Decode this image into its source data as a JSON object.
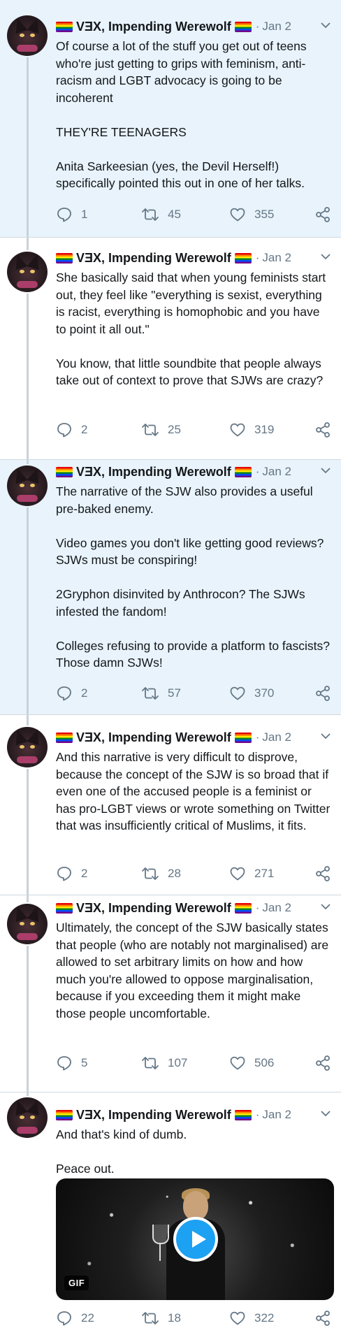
{
  "colors": {
    "shaded_bg": "#e8f3fb",
    "text": "#14171a",
    "muted": "#657786",
    "play_button": "#1da1f2"
  },
  "tweets": [
    {
      "name": "VƎX, Impending Werewolf",
      "dot": "·",
      "date": "Jan 2",
      "paragraphs": [
        "Of course a lot of the stuff you get out of teens who're just getting to grips with feminism, anti-racism and LGBT advocacy is going to be incoherent",
        "THEY'RE TEENAGERS",
        "Anita Sarkeesian (yes, the Devil Herself!) specifically pointed this out in one of her talks."
      ],
      "replies": "1",
      "retweets": "45",
      "likes": "355"
    },
    {
      "name": "VƎX, Impending Werewolf",
      "dot": "·",
      "date": "Jan 2",
      "paragraphs": [
        "She basically said that when young feminists start out, they feel like \"everything is sexist, everything is racist, everything is homophobic and you have to point it all out.\"",
        "You know, that little soundbite that people always take out of context to prove that SJWs are crazy?"
      ],
      "replies": "2",
      "retweets": "25",
      "likes": "319"
    },
    {
      "name": "VƎX, Impending Werewolf",
      "dot": "·",
      "date": "Jan 2",
      "paragraphs": [
        "The narrative of the SJW also provides a useful pre-baked enemy.",
        "Video games you don't like getting good reviews? SJWs must be conspiring!",
        "2Gryphon disinvited by Anthrocon? The SJWs infested the fandom!",
        "Colleges refusing to provide a platform to fascists? Those damn SJWs!"
      ],
      "replies": "2",
      "retweets": "57",
      "likes": "370"
    },
    {
      "name": "VƎX, Impending Werewolf",
      "dot": "·",
      "date": "Jan 2",
      "paragraphs": [
        "And this narrative is very difficult to disprove, because the concept of the SJW is so broad that if even one of the accused people is a feminist or has pro-LGBT views or wrote something on Twitter that was insufficiently critical of Muslims, it fits."
      ],
      "replies": "2",
      "retweets": "28",
      "likes": "271"
    },
    {
      "name": "VƎX, Impending Werewolf",
      "dot": "·",
      "date": "Jan 2",
      "paragraphs": [
        "Ultimately, the concept of the SJW basically states that people (who are notably not marginalised) are allowed to set arbitrary limits on how and how much you're allowed to oppose marginalisation, because if you exceeding them it might make those people uncomfortable."
      ],
      "replies": "5",
      "retweets": "107",
      "likes": "506"
    },
    {
      "name": "VƎX, Impending Werewolf",
      "dot": "·",
      "date": "Jan 2",
      "paragraphs": [
        "And that's kind of dumb.",
        "Peace out."
      ],
      "gif_label": "GIF",
      "replies": "22",
      "retweets": "18",
      "likes": "322"
    }
  ]
}
